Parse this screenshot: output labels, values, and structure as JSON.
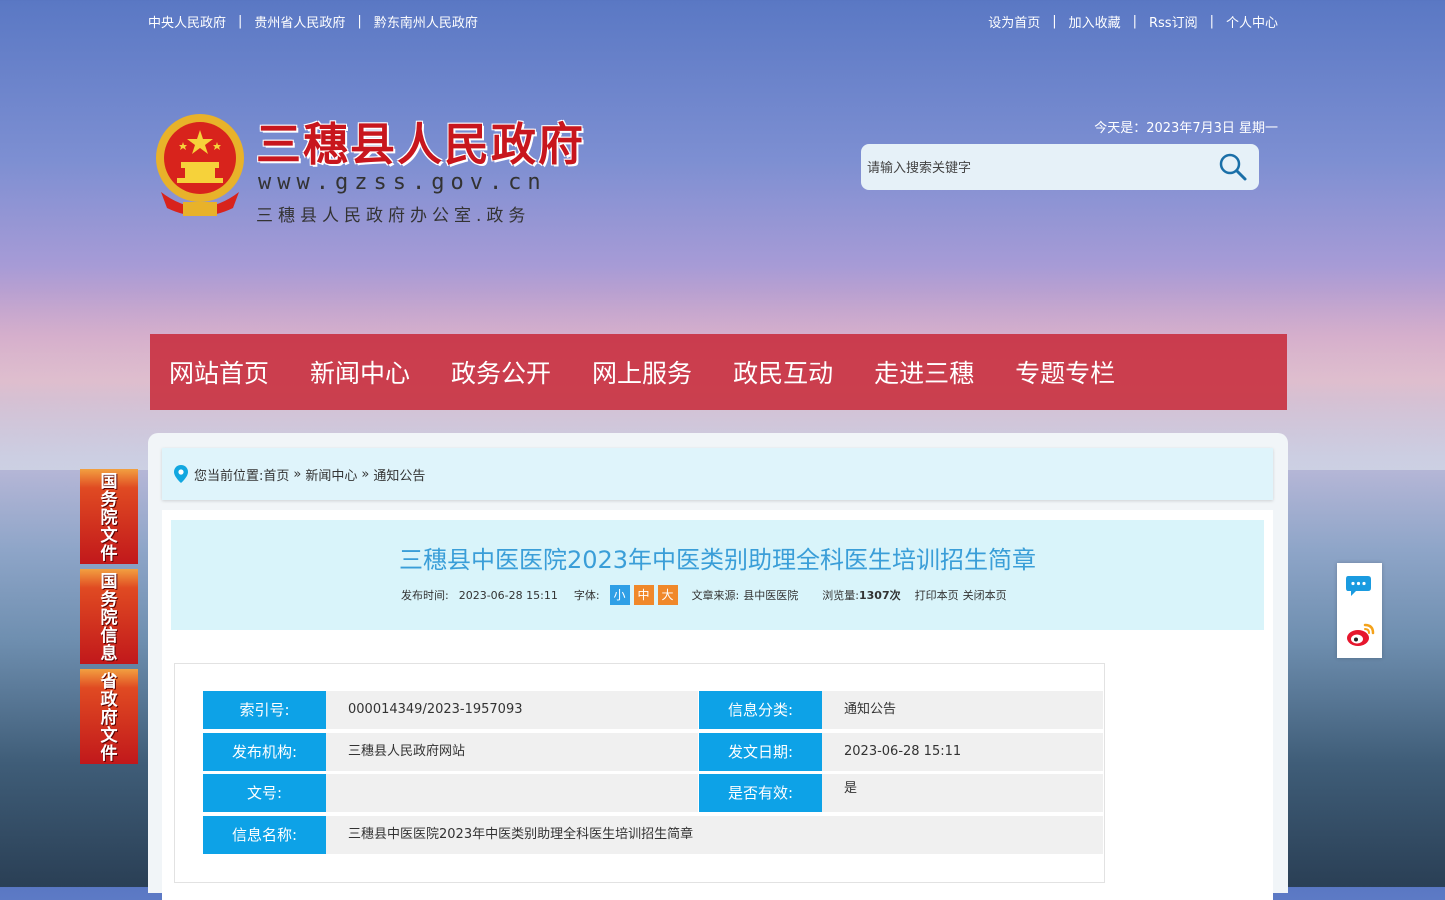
{
  "topbar": {
    "left_links": [
      "中央人民政府",
      "贵州省人民政府",
      "黔东南州人民政府"
    ],
    "right_links": [
      "设为首页",
      "加入收藏",
      "Rss订阅",
      "个人中心"
    ],
    "separator": "|"
  },
  "logo": {
    "title": "三穗县人民政府",
    "url": "www.gzss.gov.cn",
    "subtitle": "三穗县人民政府办公室.政务"
  },
  "date": "今天是：2023年7月3日 星期一",
  "search": {
    "placeholder": "请输入搜索关键字"
  },
  "nav": [
    "网站首页",
    "新闻中心",
    "政务公开",
    "网上服务",
    "政民互动",
    "走进三穗",
    "专题专栏"
  ],
  "breadcrumb": {
    "prefix": "您当前位置:",
    "items": [
      "首页",
      "新闻中心",
      "通知公告"
    ],
    "arrow": "»"
  },
  "article": {
    "title": "三穗县中医医院2023年中医类别助理全科医生培训招生简章",
    "publish_label": "发布时间:",
    "publish_time": "2023-06-28 15:11",
    "font_label": "字体:",
    "font_sizes": [
      "小",
      "中",
      "大"
    ],
    "font_colors": [
      "#2f9fe6",
      "#f0882a",
      "#f0882a"
    ],
    "source_label": "文章来源:",
    "source": "县中医医院",
    "views_label": "浏览量:",
    "views": "1307次",
    "print": "打印本页",
    "close": "关闭本页"
  },
  "info": {
    "index_label": "索引号:",
    "index_value": "000014349/2023-1957093",
    "category_label": "信息分类:",
    "category_value": "通知公告",
    "org_label": "发布机构:",
    "org_value": "三穗县人民政府网站",
    "date_label": "发文日期:",
    "date_value": "2023-06-28 15:11",
    "docno_label": "文号:",
    "docno_value": "",
    "valid_label": "是否有效:",
    "valid_value": "是",
    "name_label": "信息名称:",
    "name_value": "三穗县中医医院2023年中医类别助理全科医生培训招生简章"
  },
  "side_banners": [
    "国务院文件",
    "国务院信息",
    "省政府文件"
  ],
  "colors": {
    "nav_bg": "#c82837",
    "accent": "#0da2e7",
    "title": "#3a9ed8"
  }
}
